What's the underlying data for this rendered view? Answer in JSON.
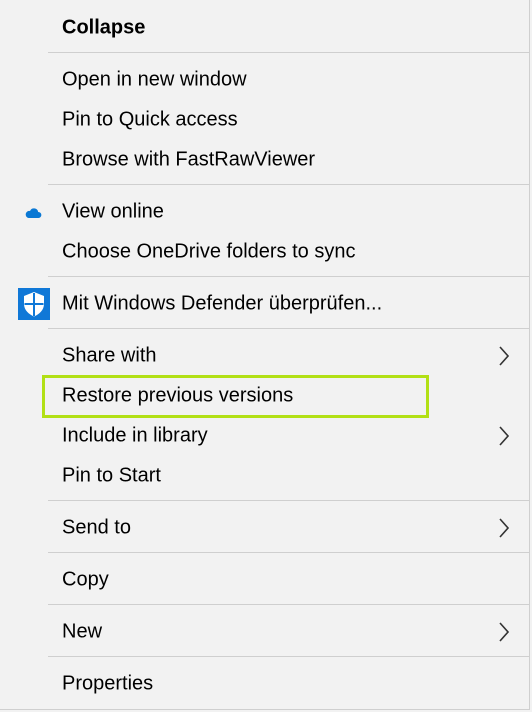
{
  "menu": {
    "items": [
      {
        "label": "Collapse",
        "bold": true
      },
      {
        "label": "Open in new window"
      },
      {
        "label": "Pin to Quick access"
      },
      {
        "label": "Browse with FastRawViewer"
      },
      {
        "label": "View online",
        "icon": "cloud-icon"
      },
      {
        "label": "Choose OneDrive folders to sync"
      },
      {
        "label": "Mit Windows Defender überprüfen...",
        "icon": "windows-defender-shield-icon"
      },
      {
        "label": "Share with",
        "submenu": true
      },
      {
        "label": "Restore previous versions",
        "highlighted": true
      },
      {
        "label": "Include in library",
        "submenu": true
      },
      {
        "label": "Pin to Start"
      },
      {
        "label": "Send to",
        "submenu": true
      },
      {
        "label": "Copy"
      },
      {
        "label": "New",
        "submenu": true
      },
      {
        "label": "Properties"
      }
    ],
    "colors": {
      "background": "#f2f2f2",
      "separator": "#cfcfcf",
      "highlight_border": "#b2e015",
      "onedrive_blue": "#0a78d4",
      "defender_blue": "#1078d7"
    }
  }
}
